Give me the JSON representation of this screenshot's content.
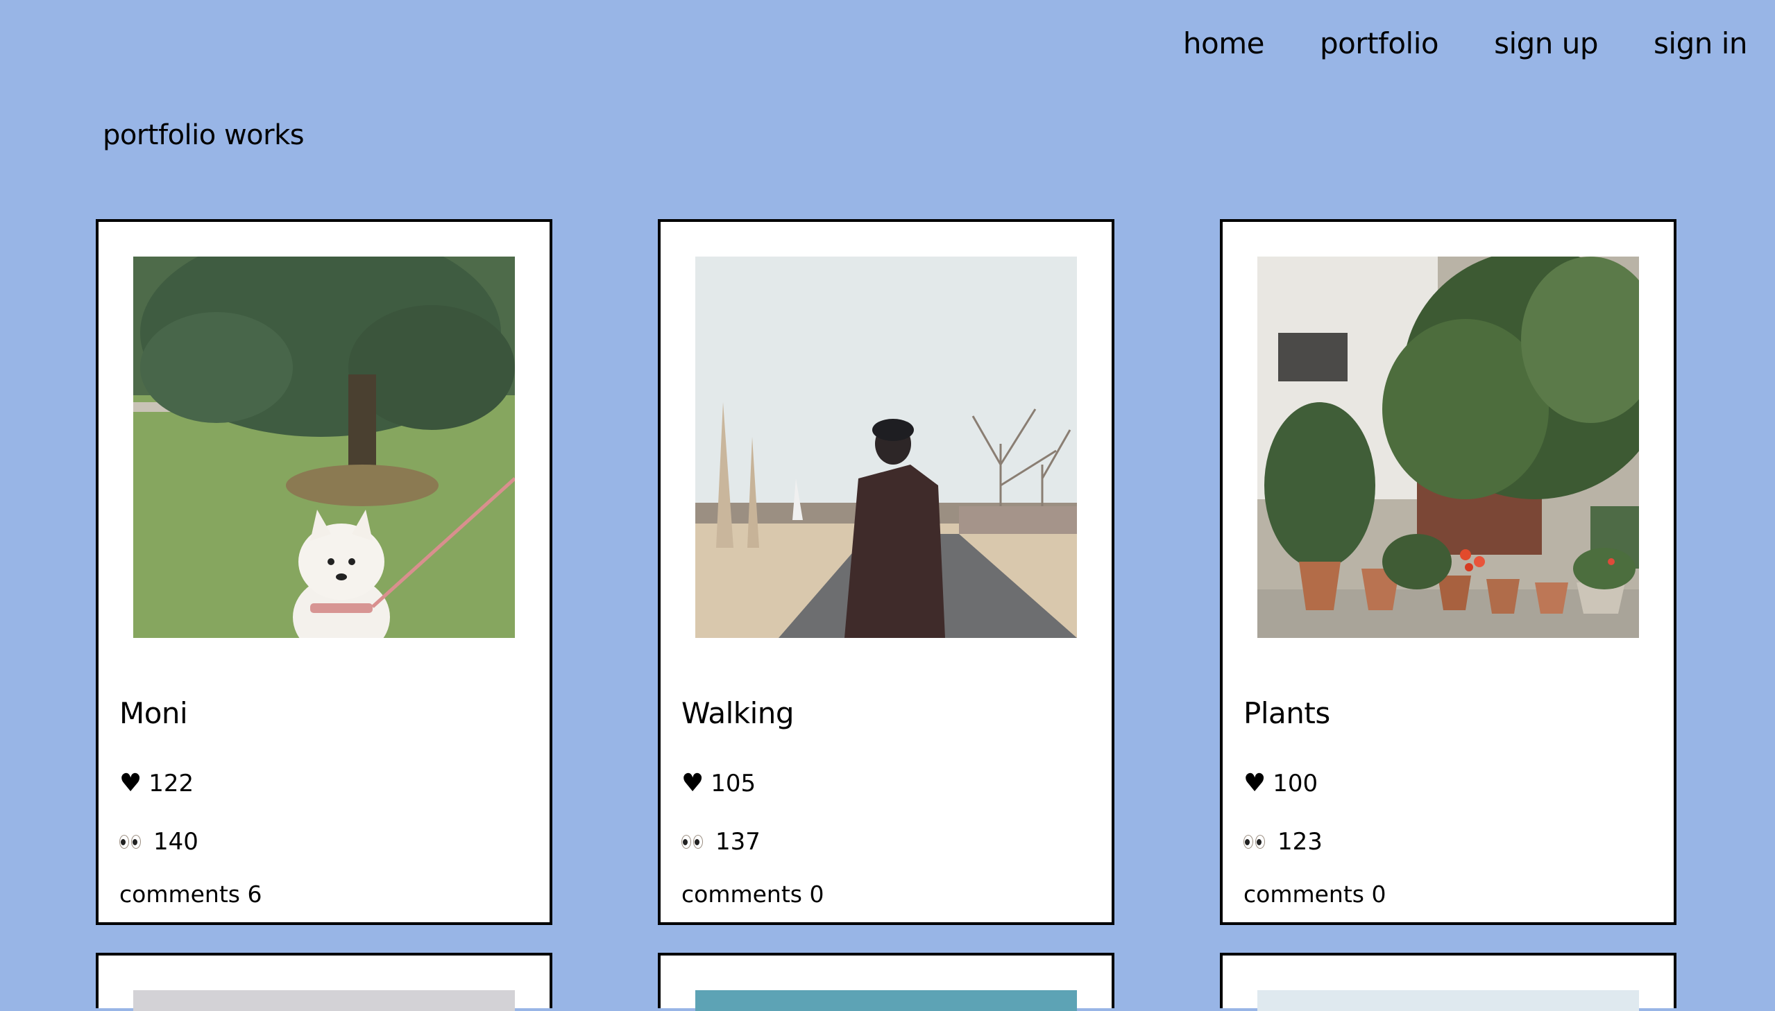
{
  "nav": {
    "items": [
      {
        "label": "home"
      },
      {
        "label": "portfolio"
      },
      {
        "label": "sign up"
      },
      {
        "label": "sign in"
      }
    ]
  },
  "page": {
    "title": "portfolio works"
  },
  "works": [
    {
      "title": "Moni",
      "likes": "122",
      "views": "140",
      "comments": "comments 6",
      "photo": "dog-on-grass-photo"
    },
    {
      "title": "Walking",
      "likes": "105",
      "views": "137",
      "comments": "comments 0",
      "photo": "man-in-coat-walking-photo"
    },
    {
      "title": "Plants",
      "likes": "100",
      "views": "123",
      "comments": "comments 0",
      "photo": "potted-plants-photo"
    }
  ],
  "icons": {
    "like": "heart-icon",
    "views": "eyes-icon"
  },
  "colors": {
    "background": "#98b5e6",
    "card": "#ffffff",
    "border": "#000000"
  }
}
